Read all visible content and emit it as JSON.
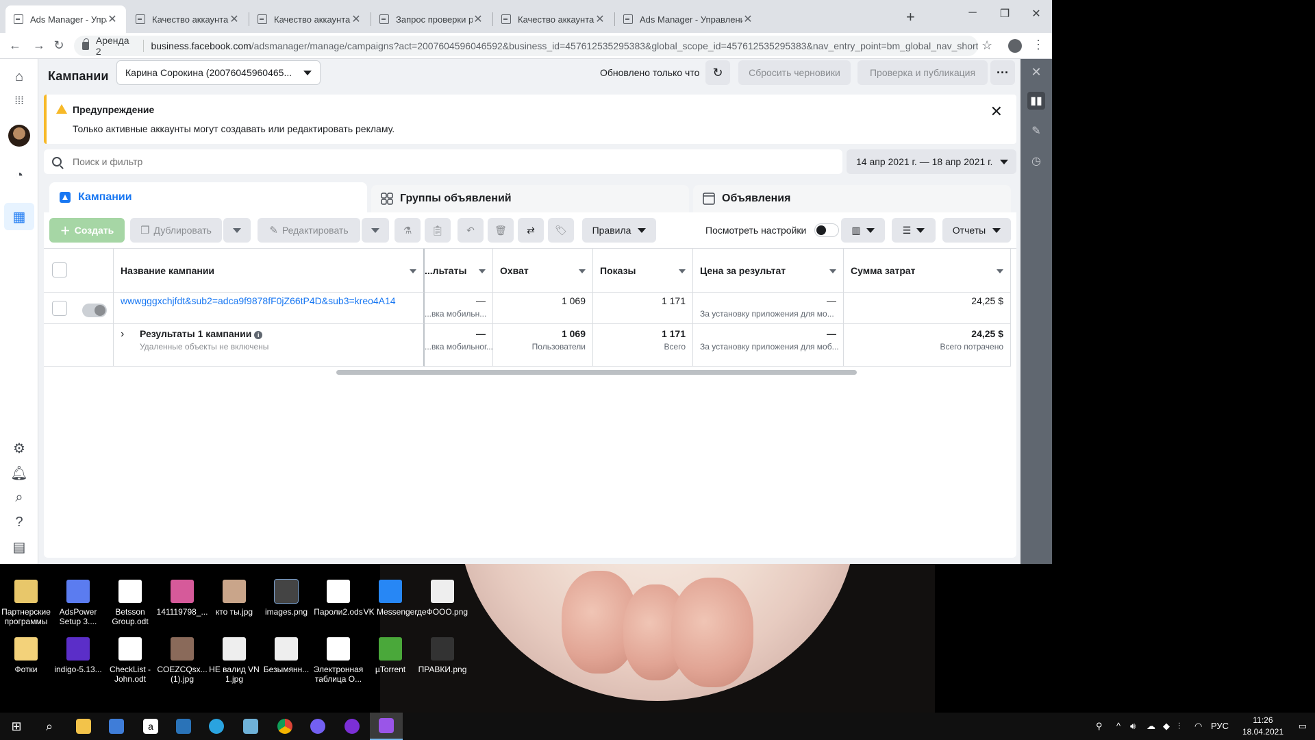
{
  "browser": {
    "tabs": [
      {
        "title": "Ads Manager - Управление",
        "active": true
      },
      {
        "title": "Качество аккаунта",
        "active": false
      },
      {
        "title": "Качество аккаунта",
        "active": false
      },
      {
        "title": "Запрос проверки рекламн",
        "active": false
      },
      {
        "title": "Качество аккаунта",
        "active": false
      },
      {
        "title": "Ads Manager - Управление",
        "active": false
      }
    ],
    "new_tab": "+",
    "window_controls": {
      "minimize": "─",
      "restore": "❐",
      "close": "✕"
    },
    "profile_chip": "Аренда 2",
    "url_host": "business.facebook.com",
    "url_path": "/adsmanager/manage/campaigns?act=2007604596046592&business_id=457612535295383&global_scope_id=457612535295383&nav_entry_point=bm_global_nav_short..."
  },
  "left_rail": {
    "icons": [
      "home-icon",
      "apps-grid-icon",
      "avatar",
      "dashboard-icon",
      "campaigns-table-icon",
      "settings-icon",
      "notifications-icon",
      "search-icon",
      "help-icon",
      "reports-icon"
    ]
  },
  "header": {
    "title": "Кампании",
    "account": "Карина Сорокина (20076045960465...",
    "updated": "Обновлено только что",
    "discard_label": "Сбросить черновики",
    "publish_label": "Проверка и публикация",
    "more_label": "···"
  },
  "warning": {
    "title": "Предупреждение",
    "text": "Только активные аккаунты могут создавать или редактировать рекламу."
  },
  "search": {
    "placeholder": "Поиск и фильтр"
  },
  "date_range": "14 апр 2021 г. — 18 апр 2021 г.",
  "level_tabs": [
    {
      "label": "Кампании",
      "active": true
    },
    {
      "label": "Группы объявлений",
      "active": false
    },
    {
      "label": "Объявления",
      "active": false
    }
  ],
  "actions": {
    "create": "Создать",
    "duplicate": "Дублировать",
    "edit": "Редактировать",
    "rules": "Правила",
    "view_settings": "Посмотреть настройки",
    "reports": "Отчеты"
  },
  "table": {
    "columns": [
      "Название кампании",
      "...льтаты",
      "Охват",
      "Показы",
      "Цена за результат",
      "Сумма затрат"
    ],
    "rows": [
      {
        "name": "wwwgggxchjfdt&sub2=adca9f9878fF0jZ66tP4D&sub3=kreo4A14",
        "results": "—",
        "results_sub": "...вка мобильн...",
        "reach": "1 069",
        "impressions": "1 171",
        "cost_per_result": "—",
        "cost_sub": "За установку приложения для мо...",
        "amount_spent": "24,25 $"
      }
    ],
    "summary": {
      "title": "Результаты 1 кампании",
      "subtitle": "Удаленные объекты не включены",
      "results": "—",
      "results_sub": "...вка мобильног...",
      "reach": "1 069",
      "reach_sub": "Пользователи",
      "impressions": "1 171",
      "impressions_sub": "Всего",
      "cost_per_result": "—",
      "cost_sub": "За установку приложения для моб...",
      "amount_spent": "24,25 $",
      "amount_sub": "Всего потрачено"
    }
  },
  "desktop": {
    "icons_row1": [
      {
        "label": "Партнерские программы",
        "icon": "chrome-icon",
        "color": "#e8c76a"
      },
      {
        "label": "AdsPower Setup 3....",
        "icon": "adspower-icon",
        "color": "#5b7cf0"
      },
      {
        "label": "Betsson Group.odt",
        "icon": "document-icon",
        "color": "#ffffff"
      },
      {
        "label": "141119798_...",
        "icon": "image-icon",
        "color": "#d65a9a"
      },
      {
        "label": "кто ты.jpg",
        "icon": "image-icon",
        "color": "#c9a58a"
      },
      {
        "label": "images.png",
        "icon": "image-icon",
        "color": "#444444"
      },
      {
        "label": "Пароли2.ods",
        "icon": "spreadsheet-icon",
        "color": "#ffffff"
      },
      {
        "label": "VK Messenger",
        "icon": "vk-icon",
        "color": "#2787f5"
      },
      {
        "label": "деФООО.png",
        "icon": "image-icon",
        "color": "#eeeeee"
      }
    ],
    "icons_row2": [
      {
        "label": "Фотки",
        "icon": "folder-icon",
        "color": "#f3d27a"
      },
      {
        "label": "indigo-5.13...",
        "icon": "indigo-icon",
        "color": "#5b2ec8"
      },
      {
        "label": "CheckList - John.odt",
        "icon": "document-icon",
        "color": "#ffffff"
      },
      {
        "label": "COEZCQsx... (1).jpg",
        "icon": "image-icon",
        "color": "#8a6a5a"
      },
      {
        "label": "НЕ валид VN 1.jpg",
        "icon": "image-icon",
        "color": "#eeeeee"
      },
      {
        "label": "Безымянн...",
        "icon": "image-icon",
        "color": "#eeeeee"
      },
      {
        "label": "Электронная таблица О...",
        "icon": "document-icon",
        "color": "#ffffff"
      },
      {
        "label": "µTorrent",
        "icon": "utorrent-icon",
        "color": "#4aa83a"
      },
      {
        "label": "ПРАВКИ.png",
        "icon": "image-icon",
        "color": "#333333"
      }
    ]
  },
  "taskbar": {
    "lang": "РУС",
    "time": "11:26",
    "date": "18.04.2021"
  }
}
